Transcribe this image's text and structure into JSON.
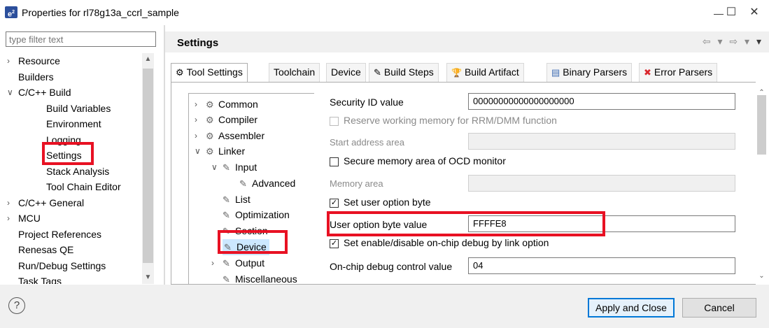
{
  "window": {
    "title": "Properties for rl78g13a_ccrl_sample",
    "app_icon_text": "e",
    "minimize": "—",
    "maximize": "☐",
    "close": "✕"
  },
  "filter": {
    "placeholder": "type filter text"
  },
  "left_tree": [
    {
      "label": "Resource",
      "arrow": ">",
      "level": 0
    },
    {
      "label": "Builders",
      "arrow": "",
      "level": 0
    },
    {
      "label": "C/C++ Build",
      "arrow": "v",
      "level": 0
    },
    {
      "label": "Build Variables",
      "arrow": "",
      "level": 1
    },
    {
      "label": "Environment",
      "arrow": "",
      "level": 1
    },
    {
      "label": "Logging",
      "arrow": "",
      "level": 1
    },
    {
      "label": "Settings",
      "arrow": "",
      "level": 1,
      "selected": true
    },
    {
      "label": "Stack Analysis",
      "arrow": "",
      "level": 1
    },
    {
      "label": "Tool Chain Editor",
      "arrow": "",
      "level": 1
    },
    {
      "label": "C/C++ General",
      "arrow": ">",
      "level": 0
    },
    {
      "label": "MCU",
      "arrow": ">",
      "level": 0
    },
    {
      "label": "Project References",
      "arrow": "",
      "level": 0
    },
    {
      "label": "Renesas QE",
      "arrow": "",
      "level": 0
    },
    {
      "label": "Run/Debug Settings",
      "arrow": "",
      "level": 0
    },
    {
      "label": "Task Tags",
      "arrow": "",
      "level": 0
    }
  ],
  "settings": {
    "title": "Settings",
    "nav_back": "⇦ ▾",
    "nav_fwd": "⇨ ▾",
    "menu": "▾"
  },
  "tabs": [
    {
      "label": "Tool Settings",
      "icon": "gear-icon",
      "glyph": "⚙",
      "active": true
    },
    {
      "label": "Toolchain",
      "icon": "",
      "glyph": ""
    },
    {
      "label": "Device",
      "icon": "",
      "glyph": ""
    },
    {
      "label": "Build Steps",
      "icon": "build-steps-icon",
      "glyph": "✎"
    },
    {
      "label": "Build Artifact",
      "icon": "trophy-icon",
      "glyph": "🏆"
    },
    {
      "label": "Binary Parsers",
      "icon": "binary-icon",
      "glyph": "▤"
    },
    {
      "label": "Error Parsers",
      "icon": "error-icon",
      "glyph": "✖"
    }
  ],
  "options_tree": [
    {
      "label": "Common",
      "arrow": ">",
      "level": 0,
      "icon": "gear-icon"
    },
    {
      "label": "Compiler",
      "arrow": ">",
      "level": 0,
      "icon": "gear-icon"
    },
    {
      "label": "Assembler",
      "arrow": ">",
      "level": 0,
      "icon": "gear-icon"
    },
    {
      "label": "Linker",
      "arrow": "v",
      "level": 0,
      "icon": "gear-icon"
    },
    {
      "label": "Input",
      "arrow": "v",
      "level": 1,
      "icon": "folder-icon"
    },
    {
      "label": "Advanced",
      "arrow": "",
      "level": 2,
      "icon": "folder-icon"
    },
    {
      "label": "List",
      "arrow": "",
      "level": 1,
      "icon": "folder-icon"
    },
    {
      "label": "Optimization",
      "arrow": "",
      "level": 1,
      "icon": "folder-icon"
    },
    {
      "label": "Section",
      "arrow": "",
      "level": 1,
      "icon": "folder-icon"
    },
    {
      "label": "Device",
      "arrow": "",
      "level": 1,
      "icon": "folder-icon",
      "selected": true
    },
    {
      "label": "Output",
      "arrow": ">",
      "level": 1,
      "icon": "folder-icon"
    },
    {
      "label": "Miscellaneous",
      "arrow": "",
      "level": 1,
      "icon": "folder-icon"
    }
  ],
  "form": {
    "security_id_label": "Security ID value",
    "security_id_value": "00000000000000000000",
    "reserve_mem_label": "Reserve working memory for RRM/DMM function",
    "start_addr_label": "Start address area",
    "start_addr_value": "",
    "secure_mem_label": "Secure memory area of OCD monitor",
    "memory_area_label": "Memory area",
    "memory_area_value": "",
    "set_user_opt_label": "Set user option byte",
    "user_opt_value_label": "User option byte value",
    "user_opt_value": "FFFFE8",
    "set_debug_label": "Set enable/disable on-chip debug by link option",
    "ocd_ctrl_label": "On-chip debug control value",
    "ocd_ctrl_value": "04",
    "check_mark": "✓"
  },
  "footer": {
    "help": "?",
    "apply_close": "Apply and Close",
    "cancel": "Cancel"
  },
  "colors": {
    "highlight": "#e81123",
    "primary_border": "#0078d7"
  }
}
